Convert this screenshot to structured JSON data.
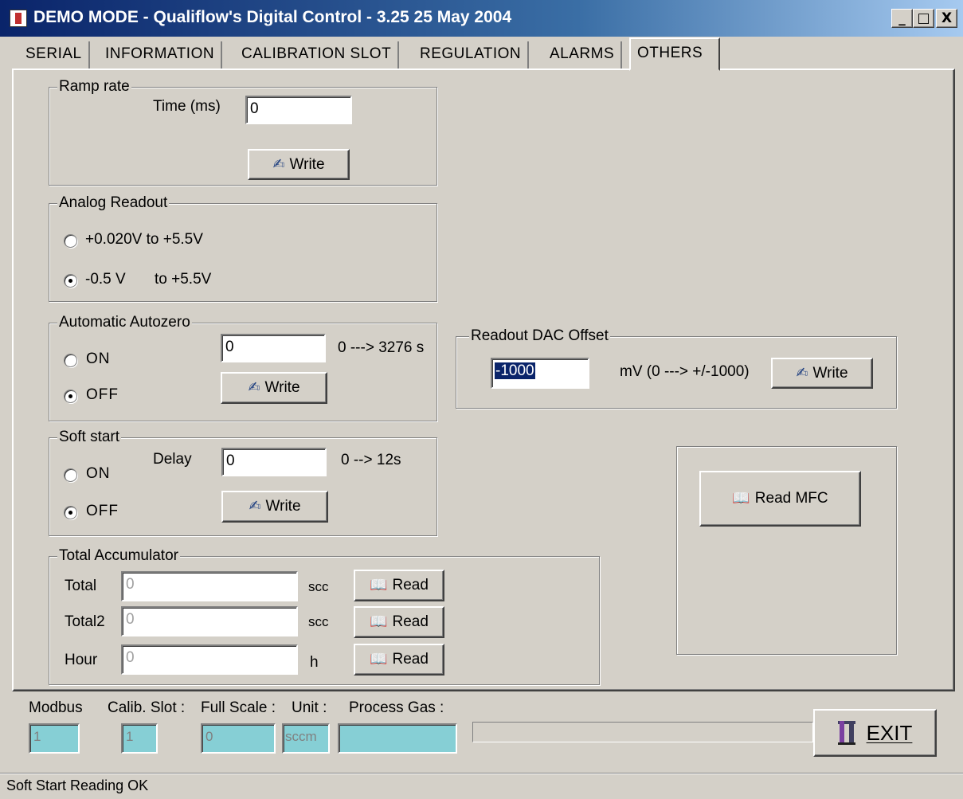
{
  "window": {
    "title": "DEMO MODE - Qualiflow's Digital Control - 3.25 25 May 2004",
    "controls": {
      "minimize": "_",
      "maximize": "□",
      "close": "X"
    }
  },
  "tabs": [
    {
      "label": "SERIAL"
    },
    {
      "label": "INFORMATION"
    },
    {
      "label": "CALIBRATION SLOT"
    },
    {
      "label": "REGULATION"
    },
    {
      "label": "ALARMS"
    },
    {
      "label": "OTHERS",
      "active": true
    }
  ],
  "ramp_rate": {
    "title": "Ramp rate",
    "time_label": "Time (ms)",
    "time_value": "0",
    "write_label": "Write"
  },
  "analog_readout": {
    "title": "Analog Readout",
    "option1": "+0.020V to +5.5V",
    "option2_a": "-0.5 V",
    "option2_b": "to +5.5V",
    "selected": "option2"
  },
  "autozero": {
    "title": "Automatic Autozero",
    "on_label": "ON",
    "off_label": "OFF",
    "selected": "OFF",
    "value": "0",
    "range": "0 ---> 3276 s",
    "write_label": "Write"
  },
  "soft_start": {
    "title": "Soft start",
    "on_label": "ON",
    "off_label": "OFF",
    "selected": "OFF",
    "delay_label": "Delay",
    "delay_value": "0",
    "range": "0 --> 12s",
    "write_label": "Write"
  },
  "accumulator": {
    "title": "Total Accumulator",
    "rows": [
      {
        "label": "Total",
        "value": "0",
        "unit": "scc",
        "button": "Read"
      },
      {
        "label": "Total2",
        "value": "0",
        "unit": "scc",
        "button": "Read"
      },
      {
        "label": "Hour",
        "value": "0",
        "unit": "h",
        "button": "Read"
      }
    ]
  },
  "dac_offset": {
    "title": "Readout DAC Offset",
    "value": "-1000",
    "range": "mV (0 ---> +/-1000)",
    "write_label": "Write"
  },
  "read_mfc": {
    "label": "Read MFC"
  },
  "footer": {
    "modbus_label": "Modbus",
    "modbus_value": "1",
    "calib_label": "Calib. Slot :",
    "calib_value": "1",
    "fullscale_label": "Full Scale :",
    "fullscale_value": "0",
    "unit_label": "Unit :",
    "unit_value": "sccm",
    "gas_label": "Process Gas :",
    "gas_value": "",
    "progress": 0,
    "exit_label": "EXIT"
  },
  "status": {
    "text": "Soft Start Reading OK"
  },
  "colors": {
    "titlebar_start": "#0a246a",
    "titlebar_end": "#a6caf0",
    "face": "#d4d0c8",
    "readonly_field": "#86cfd5",
    "selection": "#0a246a"
  }
}
